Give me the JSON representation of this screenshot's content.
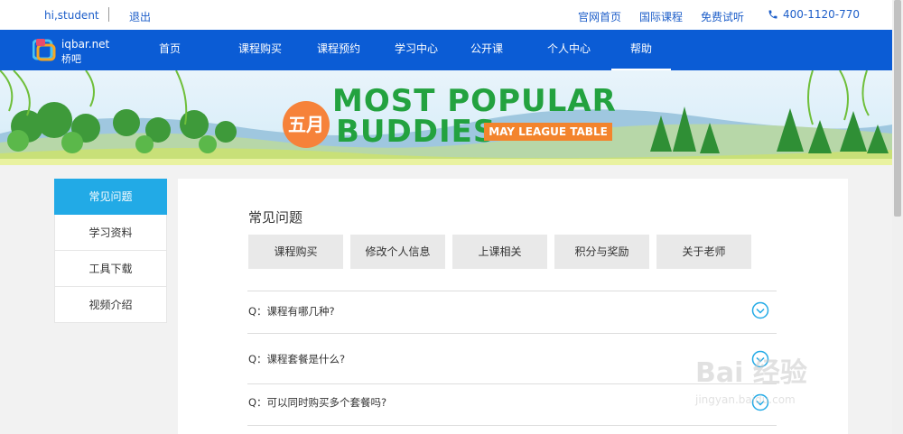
{
  "topbar": {
    "greeting": "hi,student",
    "logout": "退出",
    "links": [
      "官网首页",
      "国际课程",
      "免费试听"
    ],
    "phone": "400-1120-770"
  },
  "nav": {
    "logo_en": "iqbar.net",
    "logo_cn": "桥吧",
    "items": [
      "首页",
      "课程购买",
      "课程预约",
      "学习中心",
      "公开课",
      "个人中心",
      "帮助"
    ],
    "active": "帮助"
  },
  "banner": {
    "badge": "五月",
    "line1": "MOST POPULAR",
    "line2": "BUDDIES",
    "tag": "MAY LEAGUE TABLE"
  },
  "sidebar": {
    "items": [
      "常见问题",
      "学习资料",
      "工具下载",
      "视频介绍"
    ],
    "active": "常见问题"
  },
  "main": {
    "title": "常见问题",
    "categories": [
      "课程购买",
      "修改个人信息",
      "上课相关",
      "积分与奖励",
      "关于老师"
    ],
    "faqs": [
      "Q：课程有哪几种?",
      "Q：课程套餐是什么?",
      "Q：可以同时购买多个套餐吗?"
    ]
  },
  "watermark": {
    "brand": "Bai 经验",
    "url": "jingyan.baidu.com"
  },
  "colors": {
    "nav_blue": "#0b5cd5",
    "active_blue": "#22aae6",
    "link_blue": "#1d5ec9",
    "banner_green": "#23a23f",
    "banner_orange": "#f3842d"
  }
}
